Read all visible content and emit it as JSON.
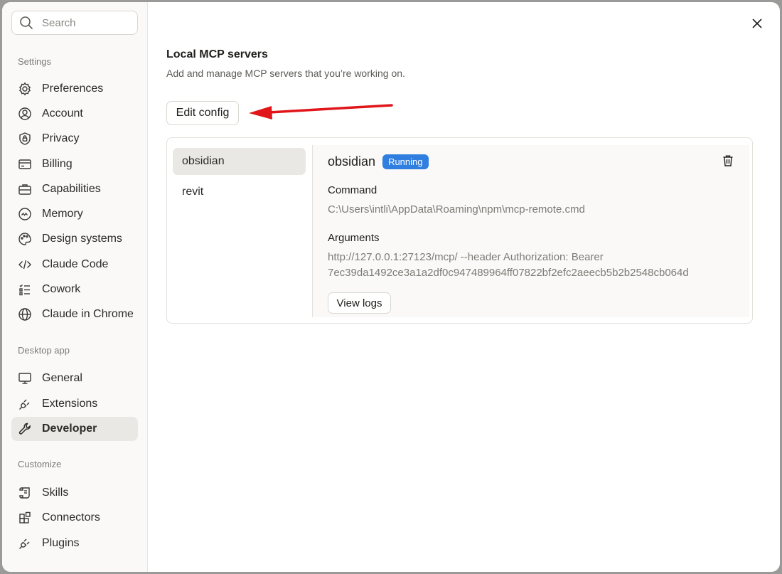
{
  "search": {
    "placeholder": "Search"
  },
  "sidebar": {
    "sections": [
      {
        "label": "Settings"
      },
      {
        "label": "Desktop app"
      },
      {
        "label": "Customize"
      }
    ],
    "items": [
      {
        "label": "Preferences",
        "icon": "gear-icon"
      },
      {
        "label": "Account",
        "icon": "user-circle-icon"
      },
      {
        "label": "Privacy",
        "icon": "shield-lock-icon"
      },
      {
        "label": "Billing",
        "icon": "credit-card-icon"
      },
      {
        "label": "Capabilities",
        "icon": "toolbox-icon"
      },
      {
        "label": "Memory",
        "icon": "memory-icon"
      },
      {
        "label": "Design systems",
        "icon": "palette-icon"
      },
      {
        "label": "Claude Code",
        "icon": "code-icon"
      },
      {
        "label": "Cowork",
        "icon": "checklist-icon"
      },
      {
        "label": "Claude in Chrome",
        "icon": "globe-icon"
      },
      {
        "label": "General",
        "icon": "monitor-icon"
      },
      {
        "label": "Extensions",
        "icon": "plug-icon"
      },
      {
        "label": "Developer",
        "icon": "wrench-icon",
        "active": true
      },
      {
        "label": "Skills",
        "icon": "scroll-icon"
      },
      {
        "label": "Connectors",
        "icon": "blocks-icon"
      },
      {
        "label": "Plugins",
        "icon": "plug-icon"
      }
    ]
  },
  "main": {
    "title": "Local MCP servers",
    "subtitle": "Add and manage MCP servers that you’re working on.",
    "edit_config_label": "Edit config",
    "servers": [
      {
        "name": "obsidian",
        "active": true
      },
      {
        "name": "revit"
      }
    ],
    "detail": {
      "name": "obsidian",
      "status": "Running",
      "command_label": "Command",
      "command_value": "C:\\Users\\intli\\AppData\\Roaming\\npm\\mcp-remote.cmd",
      "arguments_label": "Arguments",
      "arguments_line1": "http://127.0.0.1:27123/mcp/ --header Authorization: Bearer",
      "arguments_line2": "7ec39da1492ce3a1a2df0c947489964ff07822bf2efc2aeecb5b2b2548cb064d",
      "view_logs_label": "View logs"
    }
  },
  "colors": {
    "accent_blue": "#2f7ee0",
    "annotation_arrow": "#e0161b",
    "active_bg": "#e9e8e4"
  }
}
